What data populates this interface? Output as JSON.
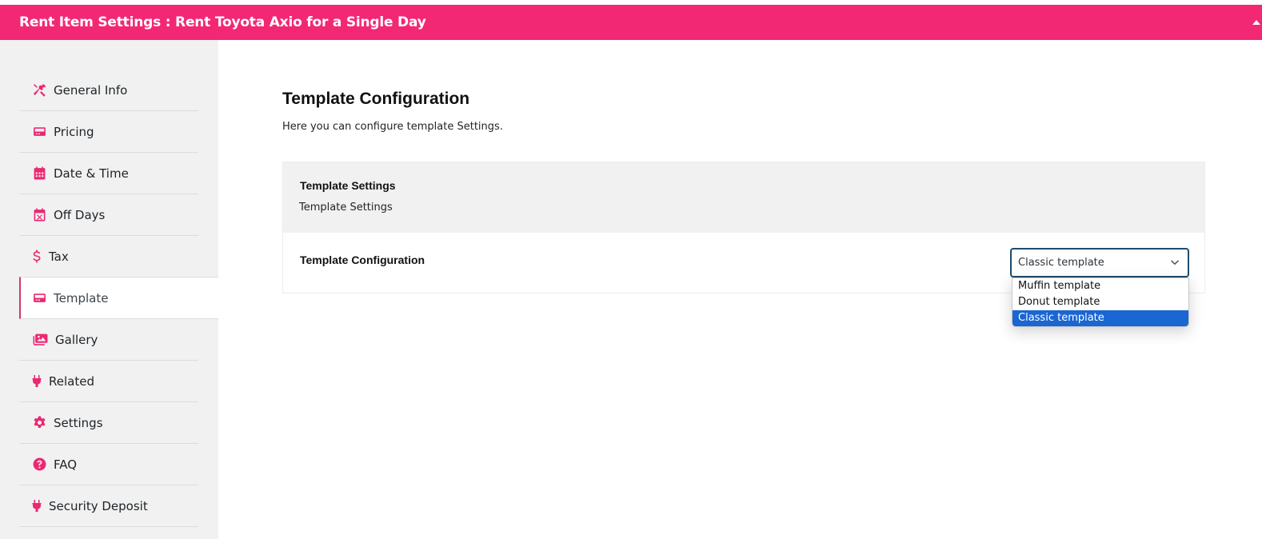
{
  "header": {
    "title": "Rent Item Settings : Rent Toyota Axio for a Single Day",
    "accent_color": "#f22874"
  },
  "sidebar": {
    "items": [
      {
        "label": "General Info",
        "icon": "tools-icon",
        "active": false
      },
      {
        "label": "Pricing",
        "icon": "card-icon",
        "active": false
      },
      {
        "label": "Date & Time",
        "icon": "calendar-icon",
        "active": false
      },
      {
        "label": "Off Days",
        "icon": "calendar-x-icon",
        "active": false
      },
      {
        "label": "Tax",
        "icon": "dollar-icon",
        "active": false
      },
      {
        "label": "Template",
        "icon": "card-icon",
        "active": true
      },
      {
        "label": "Gallery",
        "icon": "images-icon",
        "active": false
      },
      {
        "label": "Related",
        "icon": "plug-icon",
        "active": false
      },
      {
        "label": "Settings",
        "icon": "gear-icon",
        "active": false
      },
      {
        "label": "FAQ",
        "icon": "question-circle-icon",
        "active": false
      },
      {
        "label": "Security Deposit",
        "icon": "plug-icon",
        "active": false
      }
    ]
  },
  "main": {
    "title": "Template Configuration",
    "description": "Here you can configure template Settings.",
    "card": {
      "heading": "Template Settings",
      "subheading": "Template Settings",
      "row_label": "Template Configuration",
      "select": {
        "value": "Classic template",
        "options": [
          "Muffin template",
          "Donut template",
          "Classic template"
        ],
        "selected_index": 2
      }
    }
  }
}
